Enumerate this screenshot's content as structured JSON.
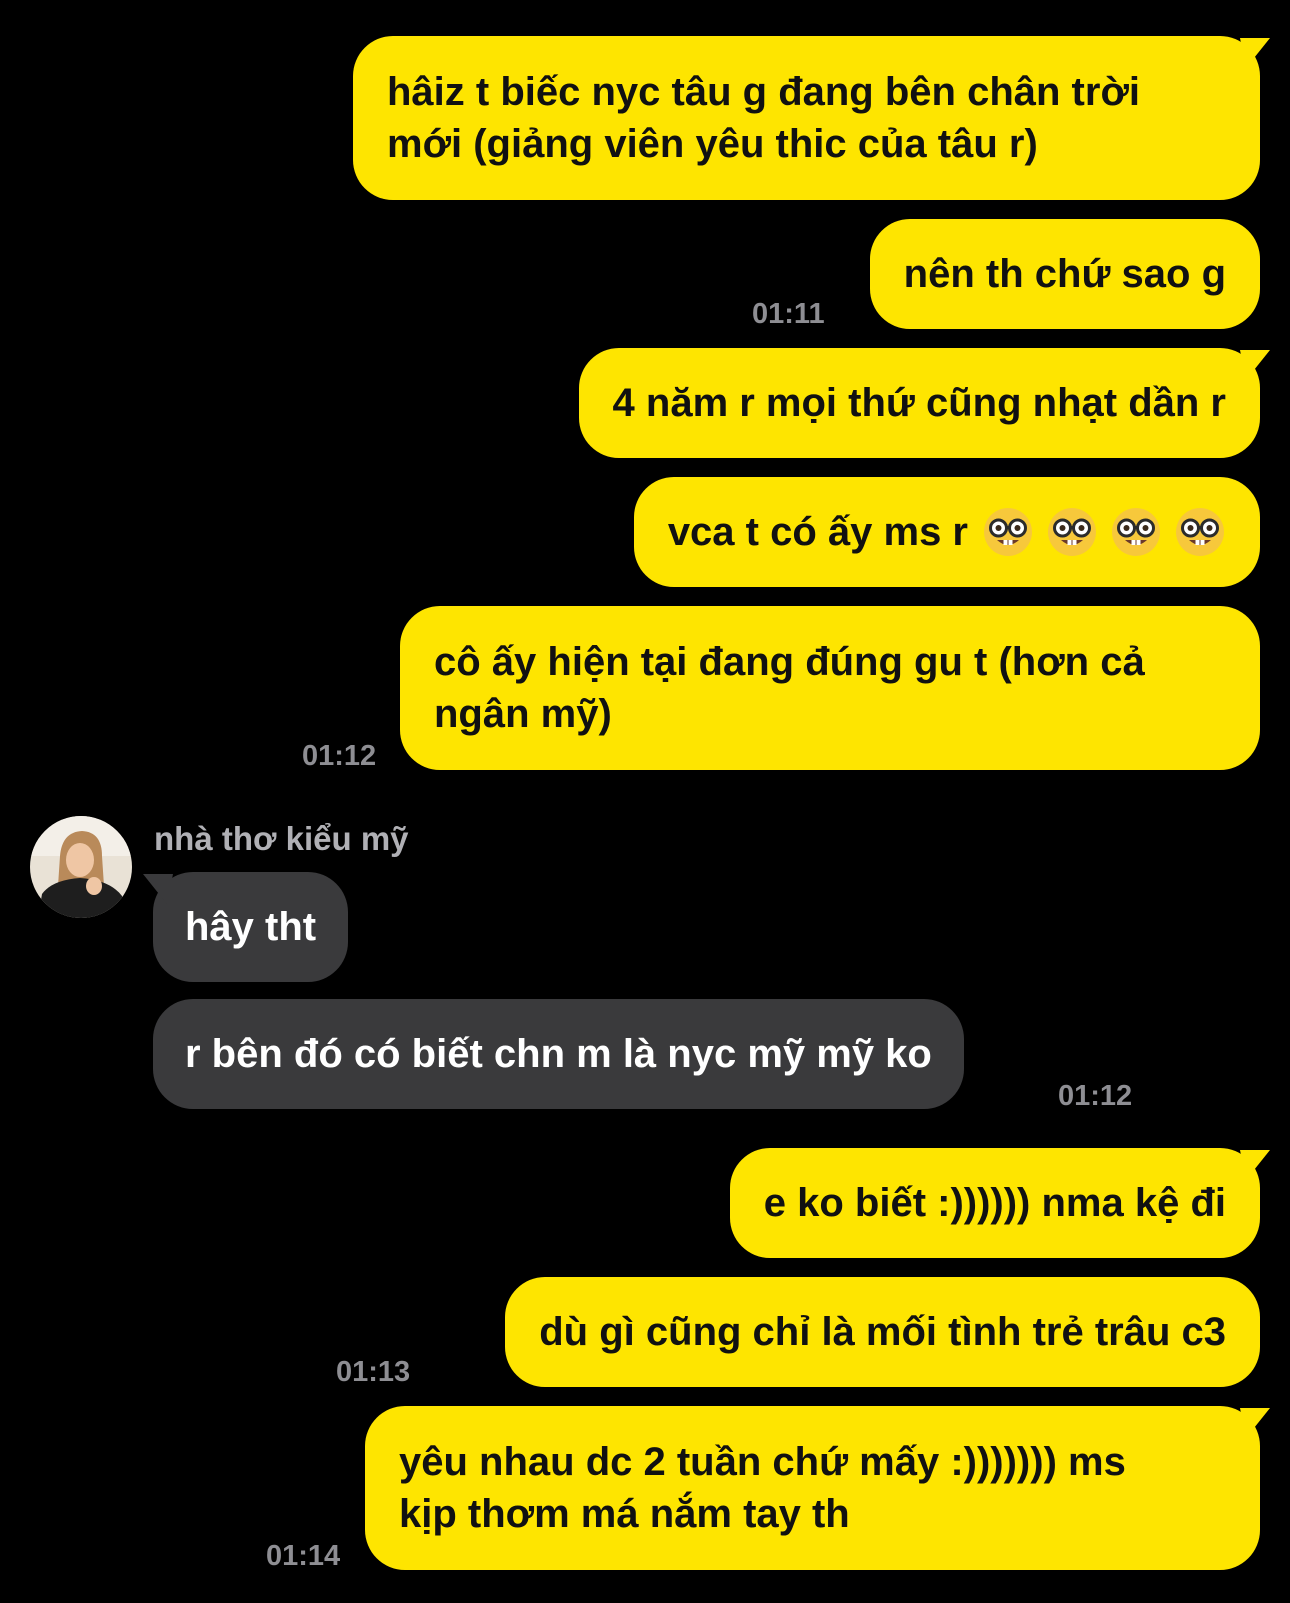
{
  "contact": {
    "name": "nhà thơ kiểu mỹ",
    "avatar": "profile-photo"
  },
  "colors": {
    "outgoing": "#FEE500",
    "incoming": "#3a3a3c",
    "background": "#000000",
    "timestamp": "#8e8e93"
  },
  "messages": [
    {
      "direction": "out",
      "lines": [
        "hâiz t biếc nyc tâu g đang bên chân trời",
        "mới (giảng viên yêu thic của tâu r)"
      ]
    },
    {
      "direction": "out",
      "text": "nên th chứ sao g",
      "time": "01:11"
    },
    {
      "direction": "out",
      "text": "4 năm r mọi thứ cũng nhạt dần r"
    },
    {
      "direction": "out",
      "text": "vca t có ấy ms r",
      "emoji": [
        "nerd-face-icon",
        "nerd-face-icon",
        "nerd-face-icon",
        "nerd-face-icon"
      ]
    },
    {
      "direction": "out",
      "lines": [
        "cô ấy hiện tại đang đúng gu t (hơn cả",
        "ngân mỹ)"
      ],
      "time": "01:12"
    },
    {
      "direction": "in",
      "text": "hây tht"
    },
    {
      "direction": "in",
      "text": "r bên đó có biết chn m là nyc mỹ mỹ ko",
      "time": "01:12"
    },
    {
      "direction": "out",
      "text": "e ko biết :)))))) nma kệ đi"
    },
    {
      "direction": "out",
      "text": "dù gì cũng chỉ là mối tình trẻ trâu c3",
      "time": "01:13"
    },
    {
      "direction": "out",
      "lines": [
        "yêu nhau dc 2 tuần chứ mấy :))))))) ms",
        "kịp thơm má nắm tay th"
      ],
      "time": "01:14"
    }
  ]
}
